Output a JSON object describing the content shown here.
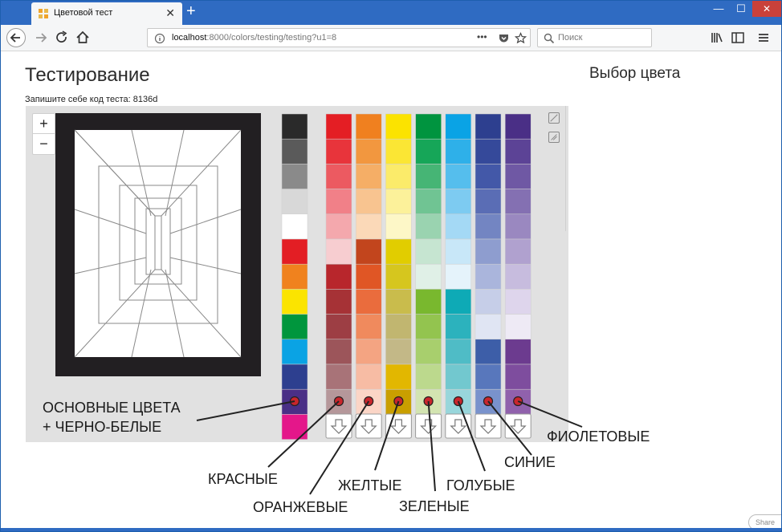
{
  "browser": {
    "tab_title": "Цветовой тест",
    "url_host": "localhost",
    "url_rest": ":8000/colors/testing/testing?u1=8",
    "search_placeholder": "Поиск",
    "url_more": "•••"
  },
  "page": {
    "title": "Тестирование",
    "code_label": "Запишите себе код теста: 8136d",
    "side_title": "Выбор цвета",
    "zoom_in": "+",
    "zoom_out": "−",
    "share": "Share"
  },
  "colors": {
    "frame": "#221f22",
    "basic": [
      "#2a2a2a",
      "#5a5a5a",
      "#8a8a8a",
      "#d8d8d8",
      "#ffffff",
      "#e31e24",
      "#f0821e",
      "#fbe400",
      "#00963d",
      "#0aa3e4",
      "#2d3f8f",
      "#4a2f86",
      "#e4178a"
    ],
    "columns": [
      [
        "#e41e24",
        "#e8343b",
        "#ec5a61",
        "#f18088",
        "#f4a8ad",
        "#f7cdd0",
        "#b8262c",
        "#a63236",
        "#9d3e44",
        "#9c555a",
        "#a87378",
        "#b5979a"
      ],
      [
        "#f0801f",
        "#f2973f",
        "#f5ae66",
        "#f8c490",
        "#fbd9b8",
        "#c2451d",
        "#e05625",
        "#ea6c3d",
        "#f08a5d",
        "#f4a482",
        "#f7bca4",
        "#fbd5c6"
      ],
      [
        "#fbe300",
        "#fbe634",
        "#fbeb6a",
        "#fcf19a",
        "#fdf7c7",
        "#e1cd00",
        "#d6c61e",
        "#c9bc4c",
        "#c1b670",
        "#c3b887",
        "#e2b700",
        "#c99f00"
      ],
      [
        "#00943f",
        "#16a658",
        "#46b575",
        "#70c493",
        "#9ad3b0",
        "#c6e5d1",
        "#e0f0e7",
        "#79b82e",
        "#93c44f",
        "#a8cf6d",
        "#bcd98d",
        "#d3e4b1"
      ],
      [
        "#0aa3e5",
        "#2eb0e9",
        "#55beed",
        "#7dcbf1",
        "#a4d9f5",
        "#c8e7f8",
        "#e5f3fb",
        "#0eaab6",
        "#2cb2bd",
        "#4fbcc6",
        "#72c8cf",
        "#98d6db"
      ],
      [
        "#2d3f8f",
        "#35499a",
        "#4358a8",
        "#5a6db5",
        "#7385c2",
        "#8e9dcf",
        "#aab5dc",
        "#c6cee8",
        "#e0e5f3",
        "#3d5ea8",
        "#5877bc",
        "#7992cc"
      ],
      [
        "#4a2f86",
        "#5c4396",
        "#6f58a4",
        "#8470b2",
        "#9a88c0",
        "#b0a1cf",
        "#c7bcde",
        "#ded5ec",
        "#eeeaf5",
        "#6c3b8f",
        "#7e4d9e",
        "#9061ac"
      ]
    ],
    "marker": "#c9262c"
  },
  "annotations": {
    "basic": [
      "ОСНОВНЫЕ ЦВЕТА",
      "+ ЧЕРНО-БЕЛЫЕ"
    ],
    "red": "КРАСНЫЕ",
    "orange": "ОРАНЖЕВЫЕ",
    "yellow": "ЖЕЛТЫЕ",
    "green": "ЗЕЛЕНЫЕ",
    "cyan": "ГОЛУБЫЕ",
    "blue": "СИНИЕ",
    "violet": "ФИОЛЕТОВЫЕ"
  }
}
